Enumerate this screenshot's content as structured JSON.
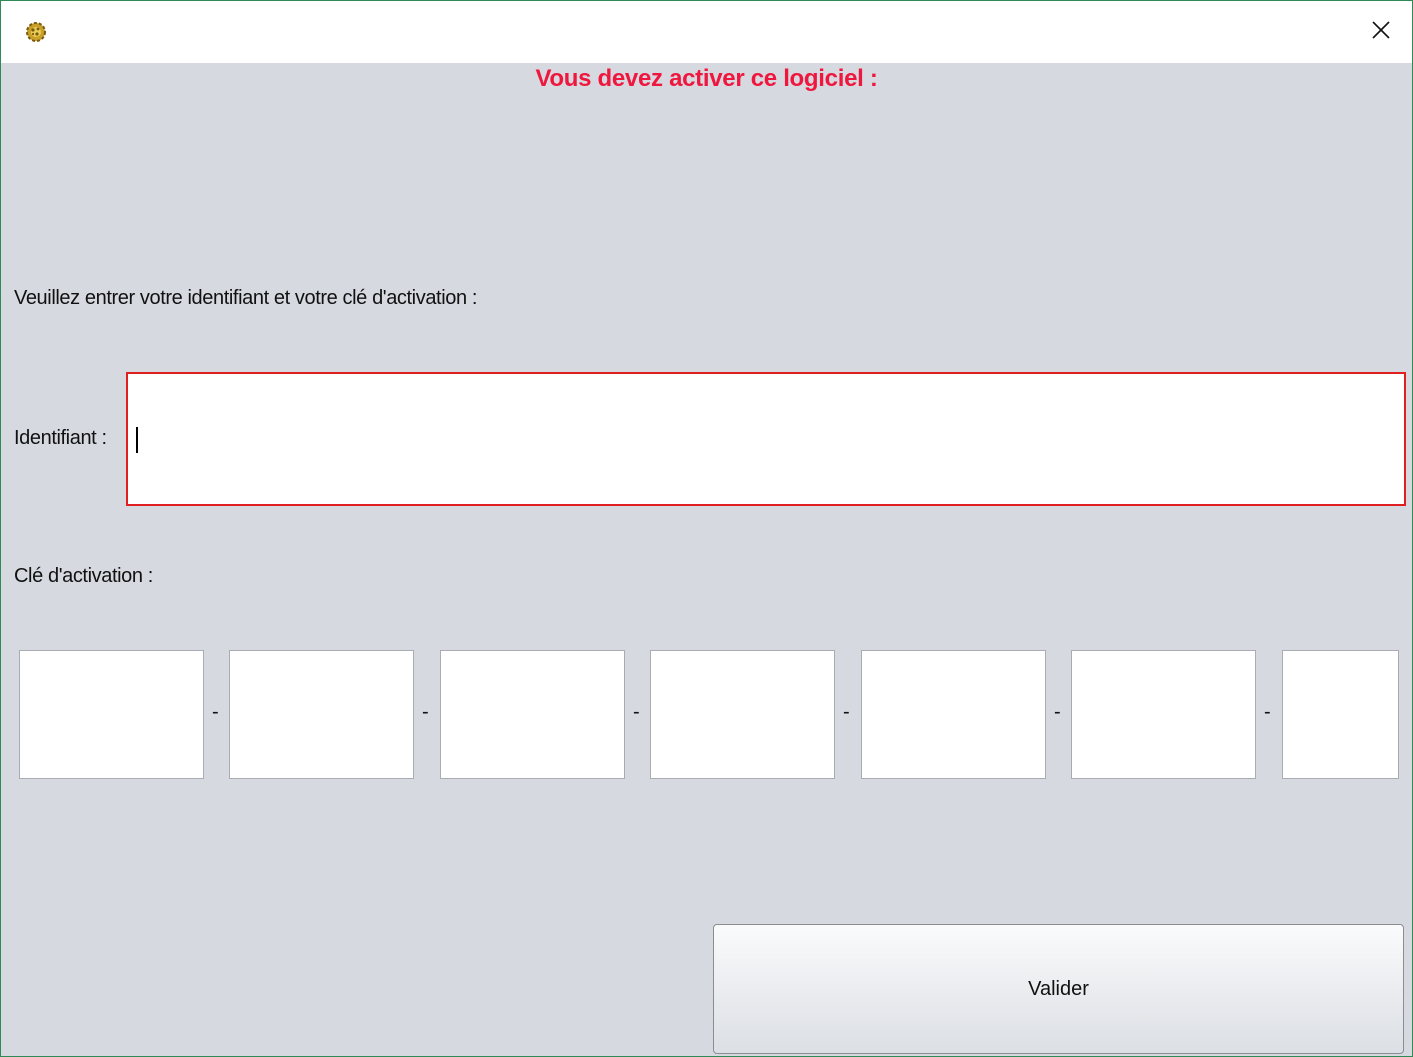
{
  "window": {
    "close_glyph": "✕",
    "icon": "app-gear-icon"
  },
  "main": {
    "heading": "Vous devez activer ce logiciel :",
    "instruction": "Veuillez entrer votre identifiant et votre clé d'activation :",
    "identifiant": {
      "label": "Identifiant :",
      "value": ""
    },
    "activation_key": {
      "label": "Clé d'activation :",
      "separator": "-",
      "segments": [
        "",
        "",
        "",
        "",
        "",
        "",
        ""
      ]
    },
    "submit_label": "Valider"
  },
  "colors": {
    "heading": "#f0173e",
    "background": "#d6d9e0",
    "invalid_border": "#e02020"
  }
}
